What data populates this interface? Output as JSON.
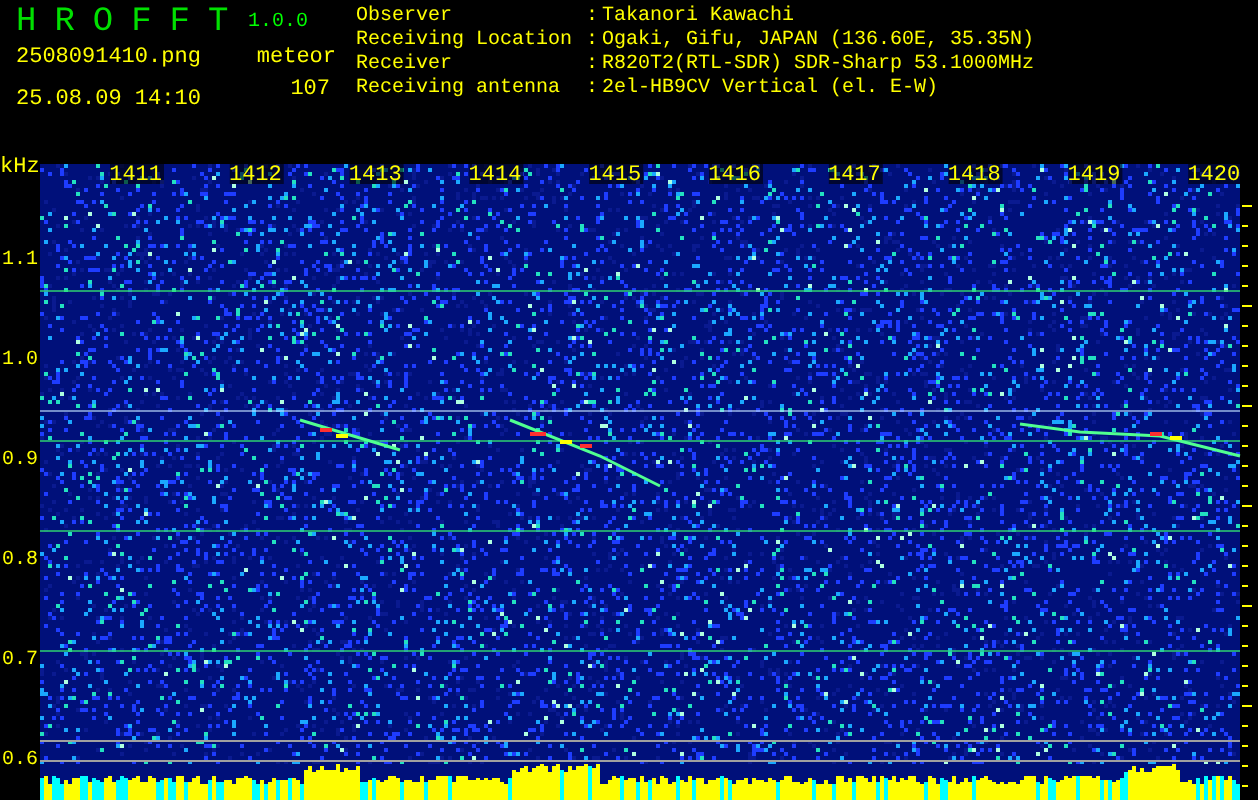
{
  "app": {
    "title": "HROFFT",
    "version": "1.0.0"
  },
  "file_name": "2508091410.png",
  "timestamp": "25.08.09 14:10",
  "meteor": {
    "label": "meteor",
    "count": "107"
  },
  "info": [
    {
      "label": "Observer",
      "separator": ":",
      "value": "Takanori Kawachi"
    },
    {
      "label": "Receiving Location",
      "separator": ":",
      "value": "Ogaki, Gifu, JAPAN (136.60E, 35.35N)"
    },
    {
      "label": "Receiver",
      "separator": ":",
      "value": "R820T2(RTL-SDR) SDR-Sharp 53.1000MHz"
    },
    {
      "label": "Receiving antenna",
      "separator": ":",
      "value": "2el-HB9CV Vertical (el. E-W)"
    }
  ],
  "spectrogram": {
    "y_unit": "kHz",
    "x_labels": [
      "1411",
      "1412",
      "1413",
      "1414",
      "1415",
      "1416",
      "1417",
      "1418",
      "1419",
      "1420"
    ],
    "y_labels": [
      "1.1",
      "1.0",
      "0.9",
      "0.8",
      "0.7",
      "0.6"
    ]
  }
}
